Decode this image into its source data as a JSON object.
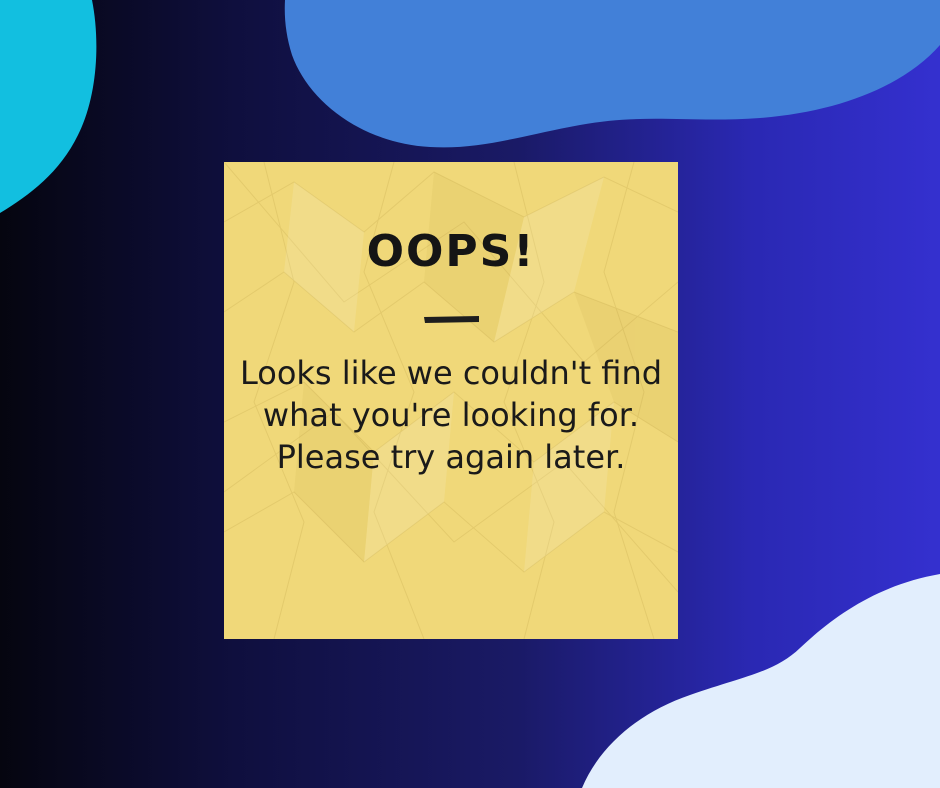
{
  "error_card": {
    "title": "OOPS!",
    "message": "Looks like we couldn't find what you're looking for. Please try again later."
  },
  "colors": {
    "background_start": "#05050f",
    "background_end": "#3430cf",
    "blob_cyan": "#12bfe0",
    "blob_blue": "#4280d8",
    "blob_light": "#e2eefd",
    "note": "#f0d879",
    "text": "#151515"
  }
}
